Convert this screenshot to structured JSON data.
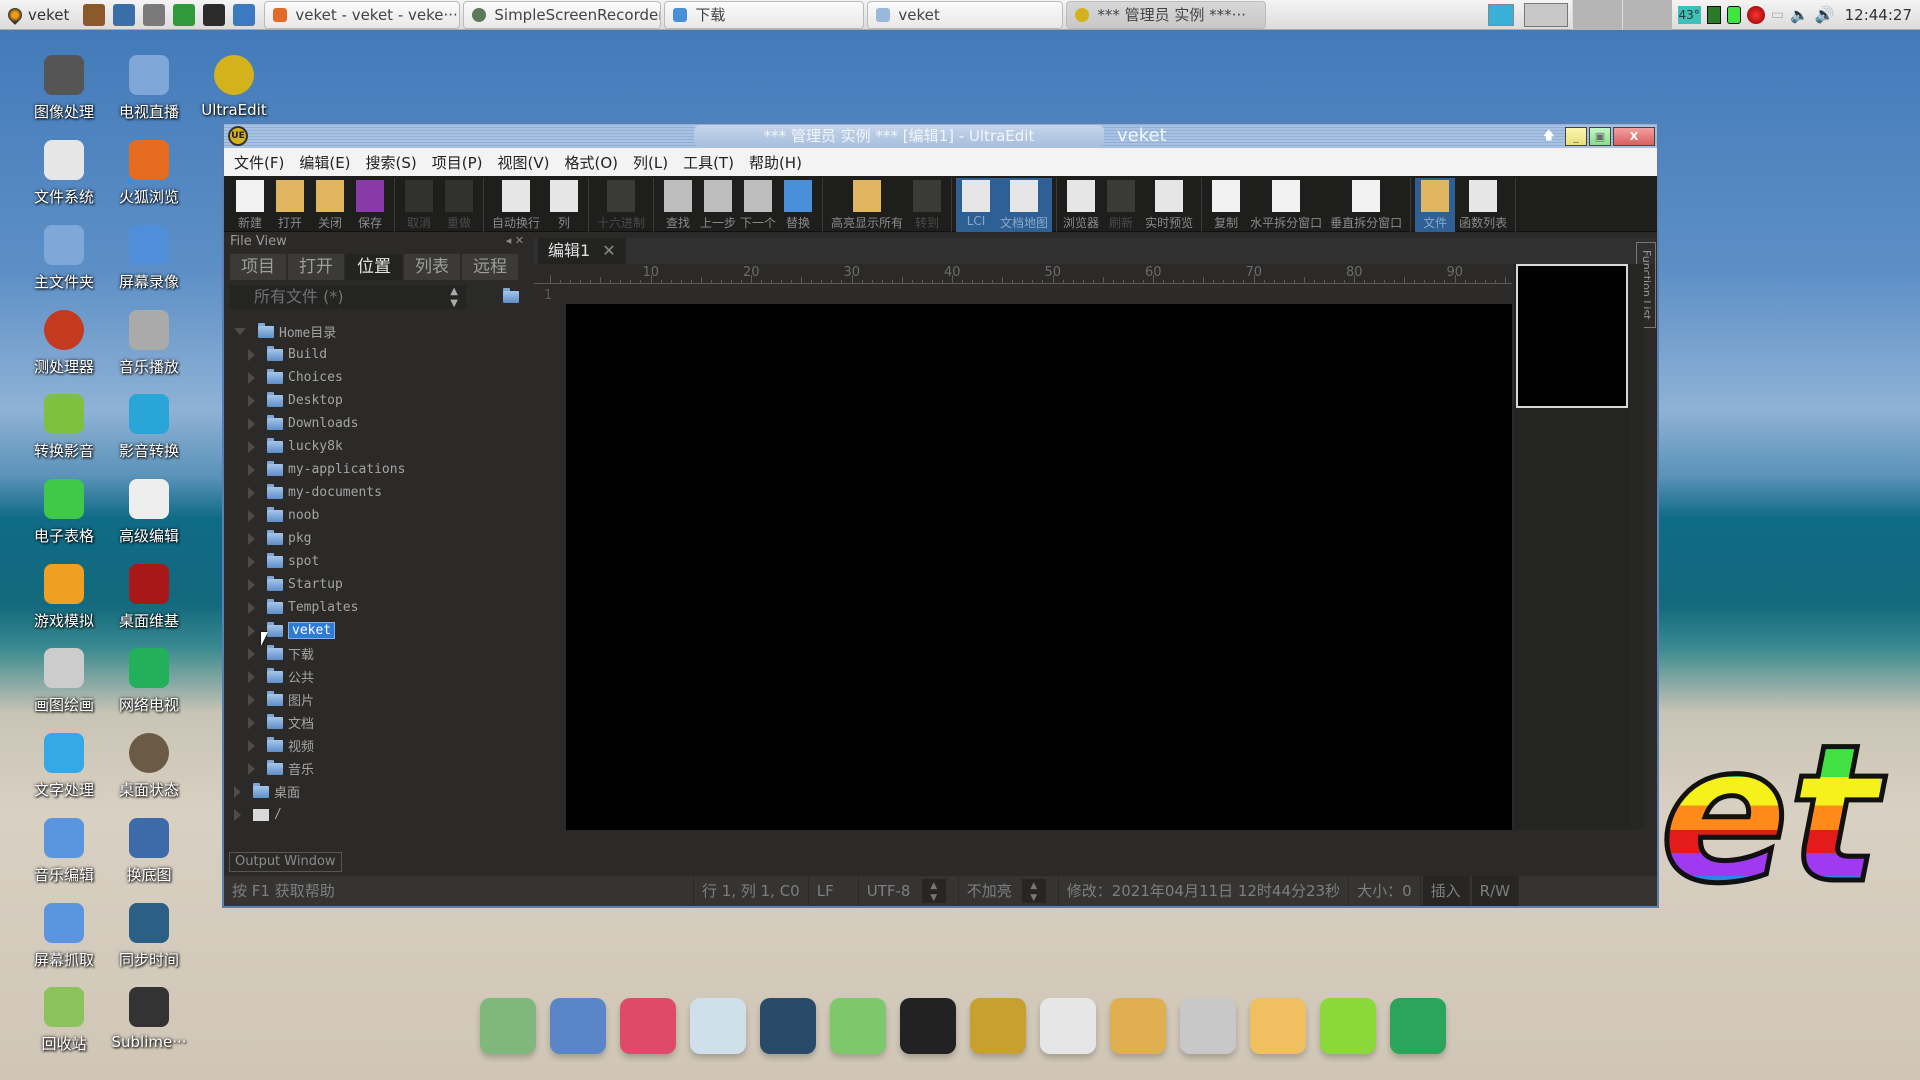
{
  "top_panel": {
    "start_label": "veket",
    "launchers": [
      "hammer-icon",
      "system-monitor-icon",
      "media-icon",
      "arrow-icon",
      "terminal-icon",
      "globe-icon"
    ],
    "tasks": [
      {
        "label": "veket - veket - veke···",
        "icon": "firefox-icon",
        "active": false
      },
      {
        "label": "SimpleScreenRecorder",
        "icon": "recorder-icon",
        "active": false
      },
      {
        "label": "下载",
        "icon": "download-folder-icon",
        "active": false
      },
      {
        "label": "veket",
        "icon": "folder-icon",
        "active": false
      },
      {
        "label": "*** 管理员 实例 ***···",
        "icon": "ultraedit-icon",
        "active": true
      }
    ],
    "tray": {
      "temperature": "43°",
      "clock": "12:44:27"
    }
  },
  "desktop_icons": [
    {
      "label": "图像处理",
      "color": "#555"
    },
    {
      "label": "电视直播",
      "color": "#7fa7d8"
    },
    {
      "label": "UltraEdit",
      "color": "#d4b21c"
    },
    {
      "label": "文件系统",
      "color": "#e6e6e6"
    },
    {
      "label": "火狐浏览",
      "color": "#e66b1f"
    },
    {
      "label": "主文件夹",
      "color": "#7ea8d8"
    },
    {
      "label": "屏幕录像",
      "color": "#4f8ed8"
    },
    {
      "label": "测处理器",
      "color": "#c43a1f"
    },
    {
      "label": "音乐播放",
      "color": "#aaa"
    },
    {
      "label": "转换影音",
      "color": "#7ec040"
    },
    {
      "label": "影音转换",
      "color": "#2aa5d8"
    },
    {
      "label": "电子表格",
      "color": "#3fc84a"
    },
    {
      "label": "高级编辑",
      "color": "#eee"
    },
    {
      "label": "游戏模拟",
      "color": "#f0a020"
    },
    {
      "label": "桌面维基",
      "color": "#a81818"
    },
    {
      "label": "画图绘画",
      "color": "#ccc"
    },
    {
      "label": "网络电视",
      "color": "#22b05a"
    },
    {
      "label": "文字处理",
      "color": "#35a8e6"
    },
    {
      "label": "桌面状态",
      "color": "#6b5a45"
    },
    {
      "label": "音乐编辑",
      "color": "#5b95e0"
    },
    {
      "label": "换底图",
      "color": "#3d6aa8"
    },
    {
      "label": "屏幕抓取",
      "color": "#5b95e0"
    },
    {
      "label": "同步时间",
      "color": "#2c5f86"
    },
    {
      "label": "回收站",
      "color": "#8cc35a"
    },
    {
      "label": "Sublime···",
      "color": "#333"
    }
  ],
  "window": {
    "title": "*** 管理员 实例 ***    [编辑1] - UltraEdit",
    "app_label": "veket",
    "menu": [
      "文件(F)",
      "编辑(E)",
      "搜索(S)",
      "项目(P)",
      "视图(V)",
      "格式(O)",
      "列(L)",
      "工具(T)",
      "帮助(H)"
    ],
    "toolbar_groups": [
      [
        {
          "label": "新建",
          "icon": "new-file-icon"
        },
        {
          "label": "打开",
          "icon": "open-folder-icon"
        },
        {
          "label": "关闭",
          "icon": "close-folder-icon"
        },
        {
          "label": "保存",
          "icon": "save-icon"
        }
      ],
      [
        {
          "label": "取消",
          "icon": "undo-icon",
          "disabled": true
        },
        {
          "label": "重做",
          "icon": "redo-icon",
          "disabled": true
        }
      ],
      [
        {
          "label": "自动换行",
          "icon": "word-wrap-icon"
        },
        {
          "label": "列",
          "icon": "column-icon"
        }
      ],
      [
        {
          "label": "十六进制",
          "icon": "hex-icon",
          "disabled": true
        }
      ],
      [
        {
          "label": "查找",
          "icon": "binoculars-icon"
        },
        {
          "label": "上一步",
          "icon": "find-prev-icon"
        },
        {
          "label": "下一个",
          "icon": "find-next-icon"
        },
        {
          "label": "替换",
          "icon": "replace-icon"
        }
      ],
      [
        {
          "label": "高亮显示所有",
          "icon": "highlight-all-icon"
        },
        {
          "label": "转到",
          "icon": "goto-icon",
          "disabled": true
        }
      ],
      [
        {
          "label": "LCI",
          "icon": "lci-icon",
          "active": true
        },
        {
          "label": "文档地图",
          "icon": "doc-map-icon",
          "active": true
        }
      ],
      [
        {
          "label": "浏览器",
          "icon": "browser-icon"
        },
        {
          "label": "刷新",
          "icon": "refresh-icon",
          "disabled": true
        },
        {
          "label": "实时预览",
          "icon": "live-preview-icon"
        }
      ],
      [
        {
          "label": "复制",
          "icon": "duplicate-window-icon"
        },
        {
          "label": "水平拆分窗口",
          "icon": "hsplit-icon"
        },
        {
          "label": "垂直拆分窗口",
          "icon": "vsplit-icon"
        }
      ],
      [
        {
          "label": "文件",
          "icon": "file-view-icon",
          "active": true
        },
        {
          "label": "函数列表",
          "icon": "function-list-icon"
        }
      ]
    ],
    "file_view": {
      "title": "File View",
      "tabs": [
        "项目",
        "打开",
        "位置",
        "列表",
        "远程"
      ],
      "active_tab": "位置",
      "filter": "所有文件 (*)",
      "root": "Home目录",
      "children": [
        "Build",
        "Choices",
        "Desktop",
        "Downloads",
        "lucky8k",
        "my-applications",
        "my-documents",
        "noob",
        "pkg",
        "spot",
        "Startup",
        "Templates",
        "veket",
        "下载",
        "公共",
        "图片",
        "文档",
        "视频",
        "音乐"
      ],
      "selected": "veket",
      "siblings": [
        "桌面",
        "/"
      ]
    },
    "editor": {
      "tab_label": "编辑1",
      "ruler_numbers": [
        "10",
        "20",
        "30",
        "40",
        "50",
        "60",
        "70",
        "80",
        "90"
      ],
      "line_numbers": [
        "1"
      ],
      "function_list_label": "Function List"
    },
    "output_window_label": "Output Window",
    "status": {
      "help": "按 F1 获取帮助",
      "position": "行 1, 列 1, C0",
      "line_ending": "LF",
      "encoding": "UTF-8",
      "highlight": "不加亮",
      "modified": "修改：2021年04月11日  12时44分23秒",
      "size": "大小：0",
      "insert_mode": "插入",
      "rw": "R/W"
    }
  },
  "dock": [
    "files-icon",
    "display-icon",
    "pet-icon",
    "notepad-icon",
    "audio-player-icon",
    "network-icon",
    "penguin-icon",
    "notebook-icon",
    "presentation-icon",
    "paint-icon",
    "usb-drive-icon",
    "veket-bear-icon",
    "help-icon",
    "camera-icon"
  ],
  "wallpaper_logo": "et"
}
